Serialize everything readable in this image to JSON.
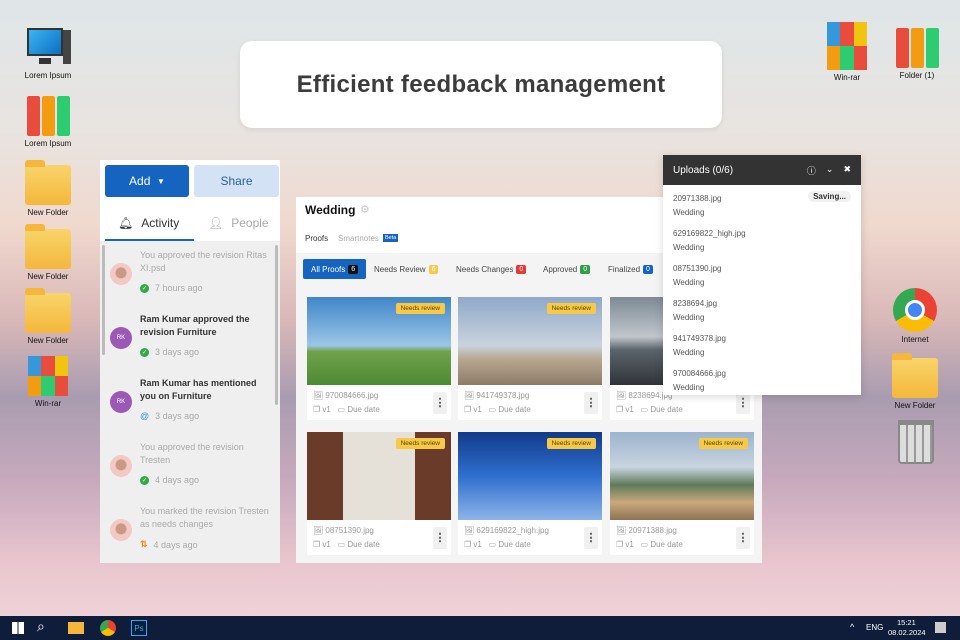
{
  "title": "Efficient feedback management",
  "desktop_left": [
    {
      "label": "Lorem Ipsum",
      "icon": "computer-icon"
    },
    {
      "label": "Lorem Ipsum",
      "icon": "binders-icon"
    },
    {
      "label": "New Folder",
      "icon": "folder-icon"
    },
    {
      "label": "New Folder",
      "icon": "folder-icon"
    },
    {
      "label": "New Folder",
      "icon": "folder-icon"
    },
    {
      "label": "Win-rar",
      "icon": "winrar-icon"
    }
  ],
  "desktop_right": [
    {
      "label": "Win-rar"
    },
    {
      "label": "Folder (1)"
    },
    {
      "label": "Internet"
    },
    {
      "label": "New Folder"
    }
  ],
  "left_panel": {
    "add": "Add",
    "share": "Share",
    "tabs": [
      "Activity",
      "People"
    ],
    "activity": [
      {
        "text": "You approved the revision Ritas XI.psd",
        "time": "7 hours ago",
        "avatar": "",
        "status": "approved"
      },
      {
        "text": "Ram Kumar approved the revision Furniture",
        "time": "3 days ago",
        "avatar": "RK",
        "status": "approved"
      },
      {
        "text": "Ram Kumar has mentioned you on Furniture",
        "time": "3 days ago",
        "avatar": "RK",
        "status": "mention"
      },
      {
        "text": "You approved the revision Tresten",
        "time": "4 days ago",
        "avatar": "",
        "status": "approved"
      },
      {
        "text": "You marked the revision Tresten as needs changes",
        "time": "4 days ago",
        "avatar": "",
        "status": "changes"
      }
    ]
  },
  "main": {
    "title": "Wedding",
    "subtabs": [
      "Proofs",
      "Smartnotes"
    ],
    "beta": "Beta",
    "filters": [
      {
        "label": "All Proofs",
        "count": "6",
        "color": "#111111"
      },
      {
        "label": "Needs Review",
        "count": "6",
        "color": "#f7c948"
      },
      {
        "label": "Needs Changes",
        "count": "0",
        "color": "#e53935"
      },
      {
        "label": "Approved",
        "count": "0",
        "color": "#2e9e4a"
      },
      {
        "label": "Finalized",
        "count": "0",
        "color": "#1565c0"
      }
    ],
    "status_badge": "Needs review",
    "version": "v1",
    "due": "Due date",
    "cards": [
      "970084666.jpg",
      "941749378.jpg",
      "8238694.jpg",
      "08751390.jpg",
      "629169822_high.jpg",
      "20971388.jpg"
    ]
  },
  "uploads": {
    "title": "Uploads (0/6)",
    "saving": "Saving...",
    "items": [
      {
        "file": "20971388.jpg",
        "project": "Wedding"
      },
      {
        "file": "629169822_high.jpg",
        "project": "Wedding"
      },
      {
        "file": "08751390.jpg",
        "project": "Wedding"
      },
      {
        "file": "8238694.jpg",
        "project": "Wedding"
      },
      {
        "file": "941749378.jpg",
        "project": "Wedding"
      },
      {
        "file": "970084666.jpg",
        "project": "Wedding"
      }
    ]
  },
  "taskbar": {
    "lang": "ENG",
    "time": "15:21",
    "date": "08.02.2024"
  }
}
